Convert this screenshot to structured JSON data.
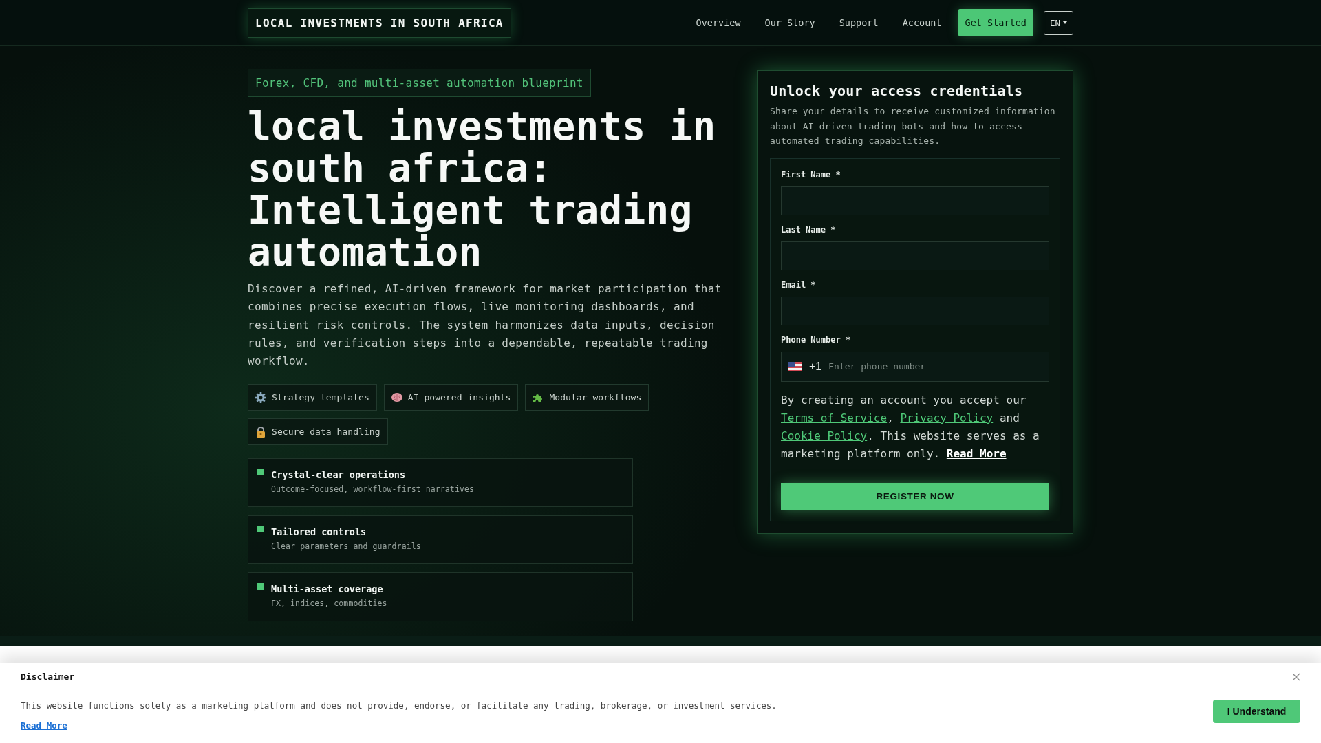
{
  "header": {
    "logo": "LOCAL INVESTMENTS IN SOUTH AFRICA",
    "nav": [
      "Overview",
      "Our Story",
      "Support",
      "Account"
    ],
    "cta": "Get Started",
    "language": "EN"
  },
  "hero": {
    "eyebrow": "Forex, CFD, and multi-asset automation blueprint",
    "title": "local investments in south africa: Intelligent trading automation",
    "description": "Discover a refined, AI-driven framework for market participation that combines precise execution flows, live monitoring dashboards, and resilient risk controls. The system harmonizes data inputs, decision rules, and verification steps into a dependable, repeatable trading workflow.",
    "tags": [
      "Strategy templates",
      "AI-powered insights",
      "Modular workflows",
      "Secure data handling"
    ],
    "features": [
      {
        "title": "Crystal-clear operations",
        "subtitle": "Outcome-focused, workflow-first narratives"
      },
      {
        "title": "Tailored controls",
        "subtitle": "Clear parameters and guardrails"
      },
      {
        "title": "Multi-asset coverage",
        "subtitle": "FX, indices, commodities"
      }
    ]
  },
  "form": {
    "title": "Unlock your access credentials",
    "description": "Share your details to receive customized information about AI-driven trading bots and how to access automated trading capabilities.",
    "fields": [
      {
        "kind": "text",
        "label": "First Name *"
      },
      {
        "kind": "text",
        "label": "Last Name *"
      },
      {
        "kind": "text",
        "label": "Email *"
      },
      {
        "kind": "phone",
        "label": "Phone Number *",
        "dial_code": "+1",
        "placeholder": "Enter phone number"
      }
    ],
    "consent": [
      {
        "kind": "text",
        "text": "By creating an account you accept our "
      },
      {
        "kind": "link",
        "text": "Terms of Service"
      },
      {
        "kind": "text",
        "text": ", "
      },
      {
        "kind": "link",
        "text": "Privacy Policy"
      },
      {
        "kind": "text",
        "text": " and "
      },
      {
        "kind": "link",
        "text": "Cookie Policy"
      },
      {
        "kind": "text",
        "text": ". This website serves as a marketing platform only. "
      },
      {
        "kind": "more",
        "text": "Read More"
      }
    ],
    "submit": "REGISTER NOW"
  },
  "disclaimer": {
    "title": "Disclaimer",
    "text": "This website functions solely as a marketing platform and does not provide, endorse, or facilitate any trading, brokerage, or investment services.",
    "link": "Read More",
    "button": "I Understand"
  }
}
